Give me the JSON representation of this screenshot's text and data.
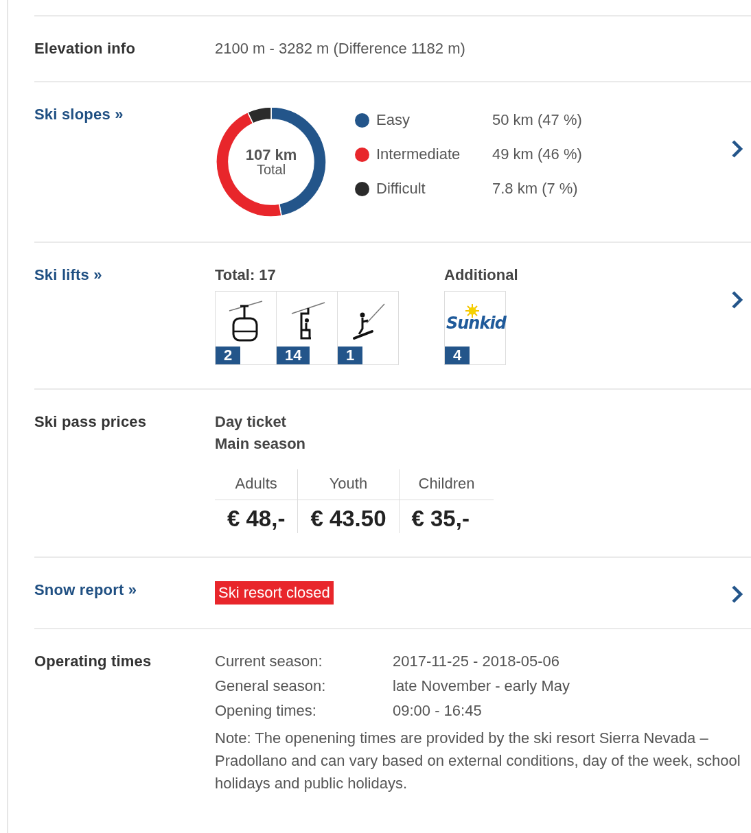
{
  "elevation": {
    "label": "Elevation info",
    "value": "2100 m - 3282 m (Difference 1182 m)"
  },
  "ski_slopes": {
    "label": "Ski slopes »",
    "center_value": "107 km",
    "center_label": "Total",
    "legend": [
      {
        "value": "50 km (47 %)",
        "color": "#23558a"
      },
      {
        "value": "49 km (46 %)",
        "color": "#e8262b"
      },
      {
        "value": "7.8 km (7 %)",
        "color": "#2b2b2b"
      }
    ],
    "chart_data": {
      "type": "donut",
      "categories": [
        "Easy",
        "Intermediate",
        "Difficult"
      ],
      "values": [
        47,
        46,
        7
      ]
    }
  },
  "ski_lifts": {
    "label": "Ski lifts »",
    "total_label": "Total: 17",
    "lifts": [
      {
        "kind": "gondola",
        "count": "2"
      },
      {
        "kind": "chairlift",
        "count": "14"
      },
      {
        "kind": "surface",
        "count": "1"
      }
    ],
    "additional_label": "Additional",
    "additional": [
      {
        "kind": "logo",
        "logo_text": "Sunkid",
        "count": "4"
      }
    ]
  },
  "ski_pass": {
    "label": "Ski pass prices",
    "ticket": "Day ticket",
    "season": "Main season",
    "prices": [
      {
        "category": "Adults",
        "price": "€ 48,-"
      },
      {
        "category": "Youth",
        "price": "€ 43.50"
      },
      {
        "category": "Children",
        "price": "€ 35,-"
      }
    ]
  },
  "snow_report": {
    "label": "Snow report »",
    "status": "Ski resort closed"
  },
  "operating_times": {
    "label": "Operating times",
    "rows": [
      {
        "label": "Current season:",
        "value": "2017-11-25 - 2018-05-06"
      },
      {
        "label": "General season:",
        "value": "late November - early May"
      },
      {
        "label": "Opening times:",
        "value": "09:00 - 16:45"
      }
    ],
    "note": "Note: The openening times are provided by the ski resort Sierra Nevada – Pradollano and can vary based on external conditions, day of the week, school holidays and public holidays."
  }
}
